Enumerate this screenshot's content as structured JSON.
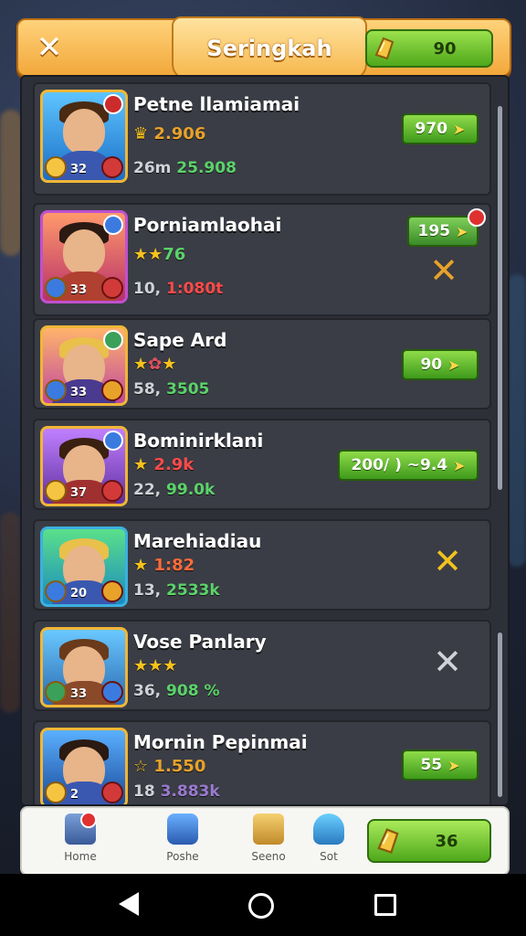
{
  "header": {
    "title": "Seringkah",
    "currency_value": "90",
    "close_icon": "close-icon",
    "currency_icon": "gold-coin-icon"
  },
  "rows": [
    {
      "name": "Petne llamiamai",
      "stat1": "2.906",
      "stat2_a": "26m",
      "stat2_b": "25.908",
      "action": "970",
      "action_kind": "button",
      "accent": "#d9a52a"
    },
    {
      "name": "Porniamlaohai",
      "stat1": "76",
      "stat2_a": "10,",
      "stat2_b": "1:080t",
      "action": "195",
      "action_kind": "button+cross",
      "accent": "#d9a52a"
    },
    {
      "name": "Sape Ard",
      "stat1": "",
      "stat2_a": "58,",
      "stat2_b": "3505",
      "action": "90",
      "action_kind": "button",
      "accent": "#d9a52a"
    },
    {
      "name": "Bominirklani",
      "stat1": "2.9k",
      "stat2_a": "22,",
      "stat2_b": "99.0k",
      "action": "200/ ) ~9.4",
      "action_kind": "button",
      "accent": "#d9a52a"
    },
    {
      "name": "Marehiadiau",
      "stat1": "1:82",
      "stat2_a": "13,",
      "stat2_b": "2533k",
      "action": "",
      "action_kind": "cross",
      "accent": "#f0c21e"
    },
    {
      "name": "Vose Panlary",
      "stat1": "",
      "stat2_a": "36,",
      "stat2_b": "908 %",
      "action": "",
      "action_kind": "cross-grey",
      "accent": "#cfd2d8"
    },
    {
      "name": "Mornin Pepinmai",
      "stat1": "1.550",
      "stat2_a": "18",
      "stat2_b": "3.883k",
      "action": "55",
      "action_kind": "button",
      "accent": "#d9a52a"
    }
  ],
  "levels": [
    "32",
    "33",
    "33",
    "37",
    "20",
    "33",
    "2"
  ],
  "bottom_nav": {
    "items": [
      {
        "label": "Home",
        "icon": "home-icon"
      },
      {
        "label": "Poshe",
        "icon": "shield-icon"
      },
      {
        "label": "Seeno",
        "icon": "scroll-icon"
      },
      {
        "label": "Sot",
        "icon": "paintbrush-icon"
      }
    ],
    "cta_value": "36"
  },
  "colors": {
    "header": "#f2a83b",
    "panel": "#2d3038",
    "button_green": "#4fa81b",
    "gold": "#f7c21c"
  }
}
